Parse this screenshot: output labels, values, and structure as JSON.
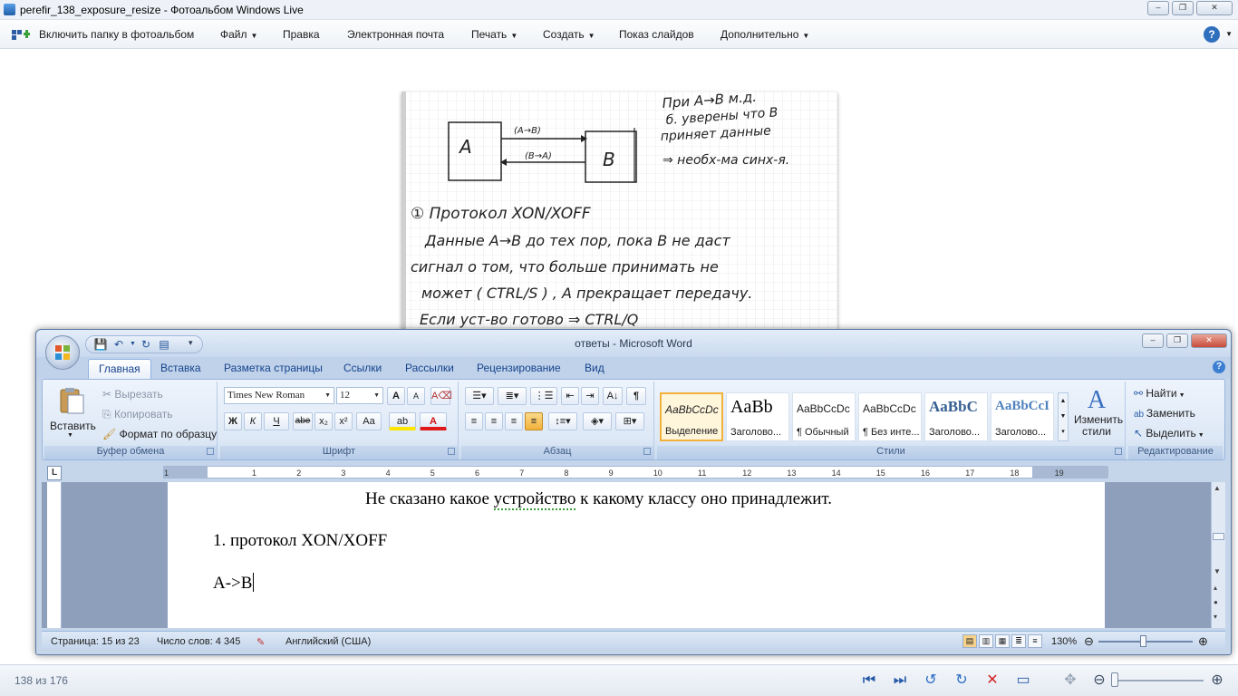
{
  "viewer": {
    "title": "perefir_138_exposure_resize - Фотоальбом Windows Live",
    "window_buttons": [
      "–",
      "❐",
      "✕"
    ],
    "menu": [
      {
        "label": "Включить папку в фотоальбом",
        "dropdown": false
      },
      {
        "label": "Файл",
        "dropdown": true
      },
      {
        "label": "Правка",
        "dropdown": false
      },
      {
        "label": "Электронная почта",
        "dropdown": false
      },
      {
        "label": "Печать",
        "dropdown": true
      },
      {
        "label": "Создать",
        "dropdown": true
      },
      {
        "label": "Показ слайдов",
        "dropdown": false
      },
      {
        "label": "Дополнительно",
        "dropdown": true
      }
    ],
    "help": "?",
    "photo": {
      "boxA": "A",
      "boxB": "B",
      "arrow_top": "(A→B)",
      "arrow_bottom": "(B→A)",
      "side_note": [
        "При A→B м.д.",
        "б. уверены что B",
        "приняет данные",
        "⇒ необх-ма синх-я."
      ],
      "lines": [
        "① Протокол XON/XOFF",
        "Данные A→B до тех пор, пока B не даст",
        "сигнал о том, что больше принимать не",
        "может ( CTRL/S ) , A прекращает передачу.",
        "Если уст-во готово ⇒ CTRL/Q"
      ]
    },
    "status": {
      "counter": "138 из 176"
    }
  },
  "word": {
    "title": "ответы - Microsoft Word",
    "tabs": [
      "Главная",
      "Вставка",
      "Разметка страницы",
      "Ссылки",
      "Рассылки",
      "Рецензирование",
      "Вид"
    ],
    "clipboard": {
      "paste": "Вставить",
      "cut": "Вырезать",
      "copy": "Копировать",
      "format_painter": "Формат по образцу",
      "label": "Буфер обмена"
    },
    "font": {
      "name": "Times New Roman",
      "size": "12",
      "bold": "Ж",
      "italic": "К",
      "underline": "Ч",
      "strike": "abe",
      "sub": "x₂",
      "sup": "x²",
      "case": "Aa",
      "grow": "A",
      "shrink": "A",
      "label": "Шрифт"
    },
    "paragraph": {
      "label": "Абзац"
    },
    "styles": {
      "items": [
        {
          "preview": "AaBbCcDc",
          "name": "Выделение"
        },
        {
          "preview": "AaBb",
          "name": "Заголово..."
        },
        {
          "preview": "AaBbCcDc",
          "name": "¶ Обычный"
        },
        {
          "preview": "AaBbCcDc",
          "name": "¶ Без инте..."
        },
        {
          "preview": "AaBbC",
          "name": "Заголово..."
        },
        {
          "preview": "AaBbCcI",
          "name": "Заголово..."
        }
      ],
      "change": "Изменить стили",
      "label": "Стили"
    },
    "editing": {
      "find": "Найти",
      "replace": "Заменить",
      "select": "Выделить",
      "label": "Редактирование"
    },
    "ruler_ticks": [
      "1",
      "1",
      "2",
      "3",
      "4",
      "5",
      "6",
      "7",
      "8",
      "9",
      "10",
      "11",
      "12",
      "13",
      "14",
      "15",
      "16",
      "17",
      "18",
      "19"
    ],
    "doc": {
      "line1_a": "Не сказано какое ",
      "line1_b": "устройство",
      "line1_c": " к какому классу оно принадлежит.",
      "line2": "1. протокол XON/XOFF",
      "line3": "A->B"
    },
    "status": {
      "page": "Страница: 15 из 23",
      "words": "Число слов: 4 345",
      "lang": "Английский (США)",
      "zoom": "130%"
    }
  }
}
